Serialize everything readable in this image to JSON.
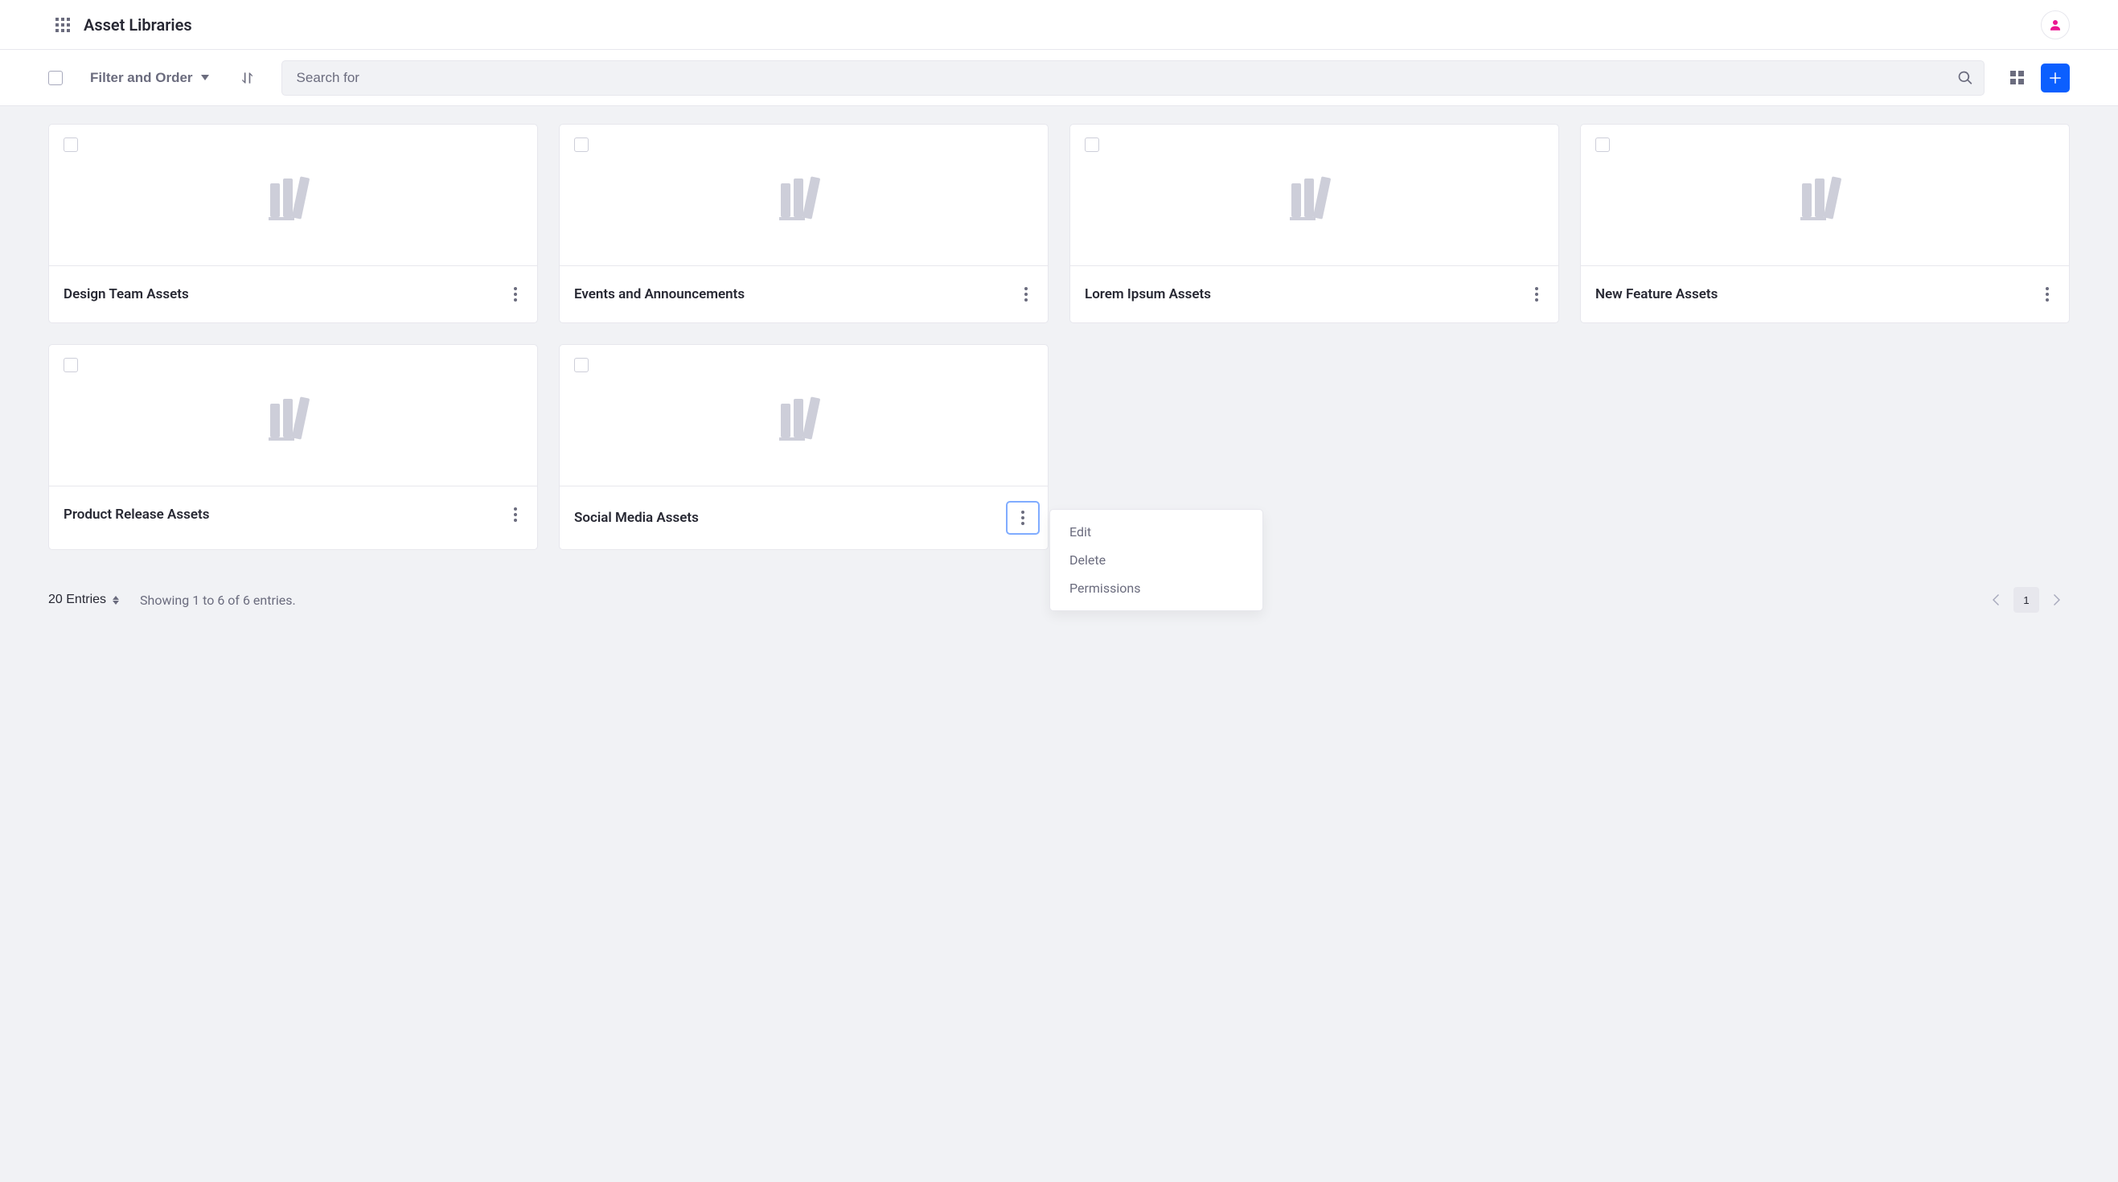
{
  "header": {
    "title": "Asset Libraries"
  },
  "toolbar": {
    "filter_label": "Filter and Order",
    "search_placeholder": "Search for"
  },
  "cards": [
    {
      "title": "Design Team Assets",
      "menu_open": false
    },
    {
      "title": "Events and Announcements",
      "menu_open": false
    },
    {
      "title": "Lorem Ipsum Assets",
      "menu_open": false
    },
    {
      "title": "New Feature Assets",
      "menu_open": false
    },
    {
      "title": "Product Release Assets",
      "menu_open": false
    },
    {
      "title": "Social Media Assets",
      "menu_open": true
    }
  ],
  "dropdown": {
    "items": [
      "Edit",
      "Delete",
      "Permissions"
    ]
  },
  "pagination": {
    "entries_label": "20 Entries",
    "showing": "Showing 1 to 6 of 6 entries.",
    "current_page": "1"
  }
}
